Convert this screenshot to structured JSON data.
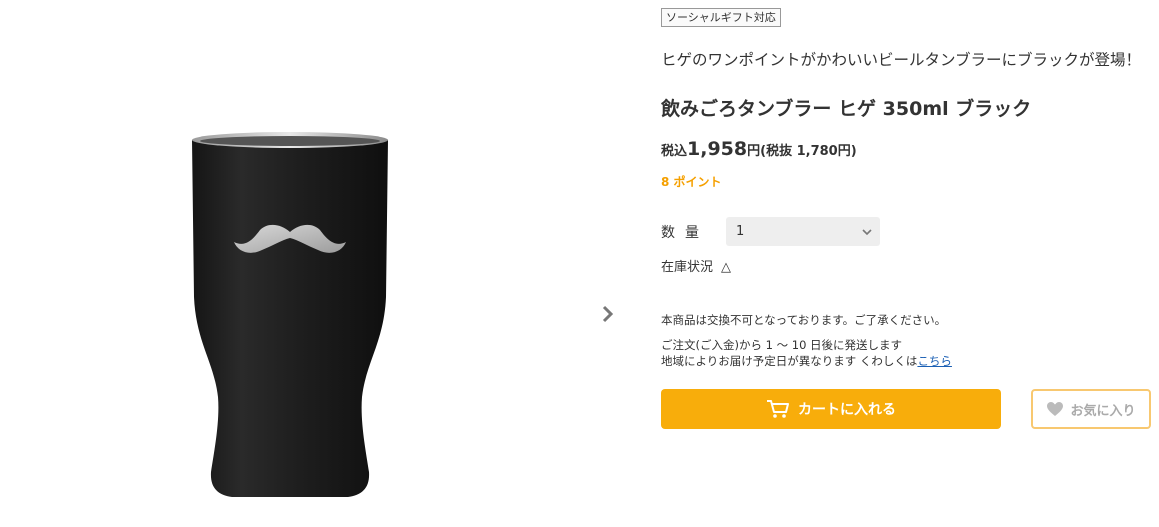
{
  "product": {
    "social_gift_badge": "ソーシャルギフト対応",
    "catch_copy": "ヒゲのワンポイントがかわいいビールタンブラーにブラックが登場！",
    "title": "飲みごろタンブラー ヒゲ 350ml ブラック",
    "price": {
      "tax_in_label": "税込",
      "amount": "1,958",
      "yen": "円",
      "tax_ex_text": "(税抜 1,780円)"
    },
    "points": "8 ポイント"
  },
  "quantity": {
    "label": "数量",
    "selected": "1"
  },
  "stock": {
    "label": "在庫状況",
    "mark": "△"
  },
  "notices": {
    "no_exchange": "本商品は交換不可となっております。ご了承ください。",
    "shipping": "ご注文(ご入金)から 1 ～ 10 日後に発送します",
    "region_text": "地域によりお届け予定日が異なります くわしくは",
    "region_link": "こちら"
  },
  "actions": {
    "cart_label": "カートに入れる",
    "favorite_label": "お気に入り"
  },
  "colors": {
    "accent": "#f8ad0b",
    "points": "#f5a000",
    "link": "#1a5fb4",
    "tumbler_body": "#1c1c1c"
  },
  "icons": {
    "next": "chevron-right-icon",
    "cart": "cart-icon",
    "favorite": "heart-icon",
    "select": "chevron-down-icon"
  }
}
